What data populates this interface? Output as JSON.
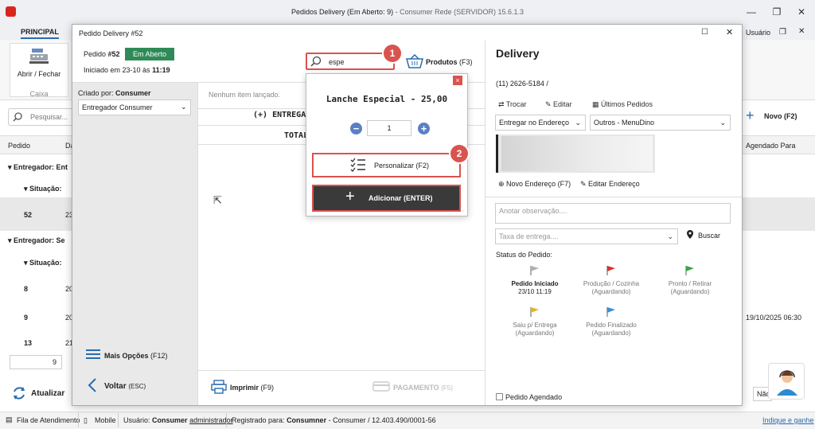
{
  "app": {
    "title": "Pedidos Delivery (Em Aberto: 9)",
    "title_suffix": " - Consumer Rede (SERVIDOR) 15.6.1.3",
    "usuario": "Usuário"
  },
  "ribbon": {
    "tab": "PRINCIPAL",
    "abrir_fechar": "Abrir / Fechar",
    "caixa": "Caixa"
  },
  "background": {
    "search_placeholder": "Pesquisar...",
    "col_pedido": "Pedido",
    "col_da": "Da",
    "group1": "Entregador: Ent",
    "situacao": "Situação:",
    "row_52": "52",
    "row_52_d": "23",
    "group2": "Entregador: Se",
    "row_8": "8",
    "row_8_d": "20",
    "row_9": "9",
    "row_9_d": "20",
    "row_13": "13",
    "row_13_d": "21",
    "pager": "9",
    "atualizar": "Atualizar",
    "novo": "Novo (F2)",
    "agendado_para": "Agendado Para",
    "agendado_value": "19/10/2025 06:30",
    "nao": "Não"
  },
  "statusbar": {
    "fila": "Fila de Atendimento",
    "mobile": "Mobile",
    "usuario_label": "Usuário:",
    "usuario_name": "Consumer",
    "usuario_role": "administrador",
    "registrado_label": "Registrado para:",
    "registrado_name": "Consumner",
    "registrado_rest": "- Consumer / 12.403.490/0001-56",
    "indique": "Indique e ganhe"
  },
  "dialog": {
    "title": "Pedido Delivery #52",
    "pedido_label": "Pedido",
    "pedido_num": "#52",
    "status": "Em Aberto",
    "iniciado_label": "Iniciado em 23-10 às",
    "iniciado_time": "11:19",
    "criado_label": "Criado por:",
    "criado_name": "Consumer",
    "entregador": "Entregador Consumer",
    "mais_opcoes": "Mais Opções",
    "mais_opcoes_key": "(F12)",
    "voltar": "Voltar",
    "voltar_key": "(ESC)",
    "nenhum": "Nenhum item lançado.",
    "entrega": "(+) ENTREGA",
    "total": "TOTAL",
    "imprimir": "Imprimir",
    "imprimir_key": "(F9)",
    "pagamento": "PAGAMENTO",
    "pagamento_key": "(F5)",
    "search_value": "espe",
    "produtos": "Produtos",
    "produtos_key": "(F3)"
  },
  "popup": {
    "title": "Lanche Especial - 25,00",
    "qty": "1",
    "personalizar": "Personalizar (F2)",
    "adicionar": "Adicionar (ENTER)",
    "close": "×"
  },
  "badges": {
    "one": "1",
    "two": "2"
  },
  "delivery": {
    "title": "Delivery",
    "phone": "(11) 2626-5184 /",
    "trocar": "Trocar",
    "editar": "Editar",
    "ultimos": "Últimos Pedidos",
    "tipo": "Entregar no Endereço",
    "origem": "Outros - MenuDino",
    "novo_endereco": "Novo Endereço (F7)",
    "editar_endereco": "Editar Endereço",
    "obs_placeholder": "Anotar observação....",
    "taxa_placeholder": "Taxa de entrega....",
    "buscar": "Buscar",
    "status_label": "Status do Pedido:",
    "steps": [
      {
        "name": "Pedido Iniciado",
        "sub": "23/10 11:19",
        "color": "#b0b0b0"
      },
      {
        "name": "Produção / Cozinha",
        "sub": "(Aguardando)",
        "color": "#d9342b"
      },
      {
        "name": "Pronto / Retirar",
        "sub": "(Aguardando)",
        "color": "#3aa64a"
      },
      {
        "name": "Saiu p/ Entrega",
        "sub": "(Aguardando)",
        "color": "#e8b21c"
      },
      {
        "name": "Pedido Finalizado",
        "sub": "(Aguardando)",
        "color": "#3a8fd6"
      }
    ],
    "agendado": "Pedido Agendado"
  },
  "colors": {
    "accent": "#2e8b57",
    "highlight": "#d9534f",
    "dark_button": "#3a3a3a"
  }
}
